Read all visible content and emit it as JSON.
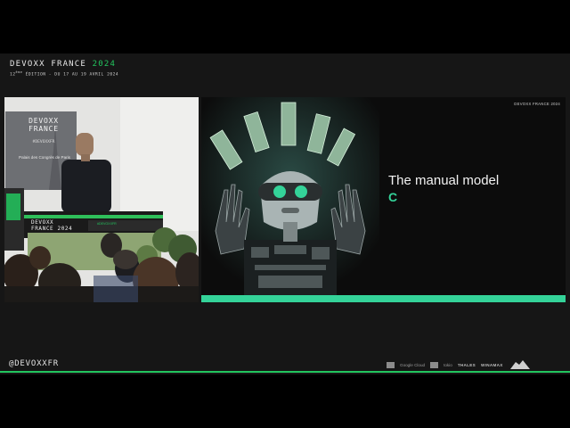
{
  "header": {
    "title_main": "DEVOXX FRANCE",
    "title_year": "2024",
    "edition_num": "12",
    "edition_sup": "ème",
    "edition_rest": " ÉDITION - DU 17 AU 19 AVRIL 2024"
  },
  "room_screen": {
    "title_line1": "DEVOXX",
    "title_line2": "FRANCE",
    "hashtag": "#DEVOXXFR",
    "venue": "Palais des Congrès de Paris"
  },
  "lectern": {
    "brand": "DEVOXX",
    "brand2": "FRANCE 2024",
    "small_label": "#DEVOXXFR"
  },
  "slide": {
    "event_tag": "DEVOXX FRANCE 2024",
    "title": "The manual model",
    "subtitle": "C",
    "accent_color": "#34d399"
  },
  "footer": {
    "handle": "@DEVOXXFR",
    "sponsors": [
      "Google Cloud",
      "tokio",
      "THALES",
      "WINAMAX"
    ]
  },
  "colors": {
    "brand_green": "#22c55e",
    "background": "#161616"
  }
}
